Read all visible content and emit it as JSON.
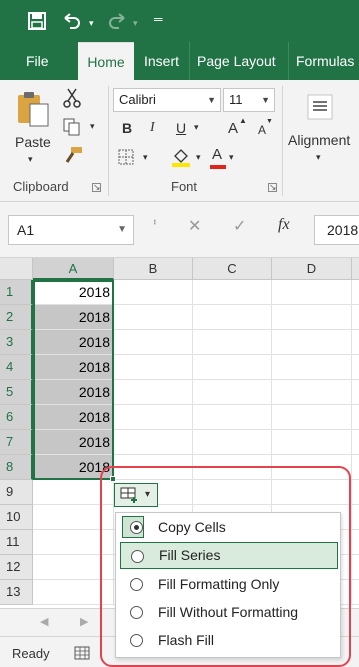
{
  "qat": {
    "save_icon": "save-icon",
    "undo_icon": "undo-icon",
    "redo_icon": "redo-icon",
    "customize_icon": "customize-qat-icon"
  },
  "tabs": [
    {
      "label": "File"
    },
    {
      "label": "Home"
    },
    {
      "label": "Insert"
    },
    {
      "label": "Page Layout"
    },
    {
      "label": "Formulas"
    }
  ],
  "ribbon": {
    "clipboard": {
      "paste_label": "Paste",
      "group_label": "Clipboard"
    },
    "font": {
      "font_name": "Calibri",
      "font_size": "11",
      "bold": "B",
      "italic": "I",
      "underline": "U",
      "grow": "A",
      "shrink": "A",
      "group_label": "Font"
    },
    "alignment": {
      "label": "Alignment"
    }
  },
  "formula_bar": {
    "name_box": "A1",
    "fx": "fx",
    "value": "2018"
  },
  "columns": [
    "A",
    "B",
    "C",
    "D"
  ],
  "rows": [
    {
      "num": "1",
      "a": "2018"
    },
    {
      "num": "2",
      "a": "2018"
    },
    {
      "num": "3",
      "a": "2018"
    },
    {
      "num": "4",
      "a": "2018"
    },
    {
      "num": "5",
      "a": "2018"
    },
    {
      "num": "6",
      "a": "2018"
    },
    {
      "num": "7",
      "a": "2018"
    },
    {
      "num": "8",
      "a": "2018"
    },
    {
      "num": "9",
      "a": ""
    },
    {
      "num": "10",
      "a": ""
    },
    {
      "num": "11",
      "a": ""
    },
    {
      "num": "12",
      "a": ""
    },
    {
      "num": "13",
      "a": ""
    }
  ],
  "autofill_menu": {
    "items": [
      {
        "label": "Copy Cells",
        "selected": true
      },
      {
        "label": "Fill Series",
        "selected": false
      },
      {
        "label": "Fill Formatting Only",
        "selected": false
      },
      {
        "label": "Fill Without Formatting",
        "selected": false
      },
      {
        "label": "Flash Fill",
        "selected": false
      }
    ]
  },
  "status": {
    "text": "Ready"
  },
  "colors": {
    "accent": "#217346",
    "highlight": "#e4424f"
  }
}
